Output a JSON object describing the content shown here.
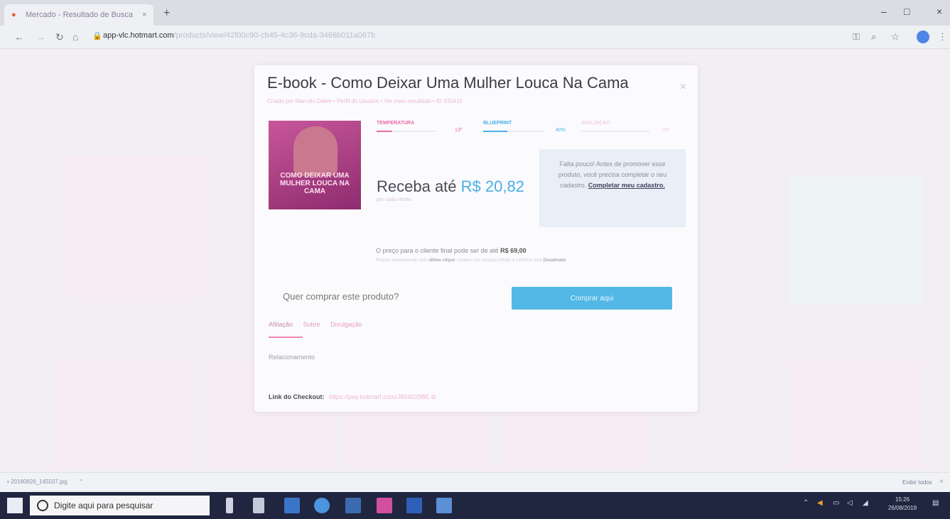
{
  "browser": {
    "tab_title": "Mercado - Resultado de Busca",
    "tab_close": "×",
    "new_tab": "+",
    "url_main": "app-vlc.hotmart.com",
    "url_path": "/products/view/42f00c90-cb45-4c36-9cda-3466b011a067b",
    "window_controls": {
      "minimize": "–",
      "maximize": "□",
      "close": "×"
    }
  },
  "modal": {
    "title": "E-book - Como Deixar Uma Mulher Louca Na Cama",
    "close": "×",
    "subtitle": "Criado por Marcelo Dalve  •  Perfil do Usuário  •  Ver mais resultado  •  ID 335415",
    "cover_caption": "COMO DEIXAR UMA MULHER LOUCA NA CAMA",
    "metrics": [
      {
        "label": "TEMPERATURA",
        "value": "13º"
      },
      {
        "label": "BLUEPRINT",
        "value": "40%"
      },
      {
        "label": "AVALIAÇÃO",
        "value": "0/5"
      }
    ],
    "receba_label": "Receba até",
    "receba_amount": "R$ 20,82",
    "receba_note": "por cada venda",
    "info_text": "Falta pouco! Antes de promover esse produto, você precisa completar o seu cadastro.",
    "info_link": "Completar meu cadastro.",
    "price_text": "O preço para o cliente final pode ser de até",
    "price_value": "R$ 69,00",
    "fine_prefix": "Produto comissionado pelo",
    "fine_bold1": "último clique",
    "fine_mid": ", cookies com duração infinita e o Prêmio está",
    "fine_bold2": "Desativado",
    "buy_question": "Quer comprar este produto?",
    "buy_button": "Comprar aqui",
    "tabs": [
      "Afiliação",
      "Sobre",
      "Divulgação"
    ],
    "section": "Relacionamento",
    "checkout_label": "Link do Checkout:",
    "checkout_url": "https://pay.hotmart.com/J8040298E"
  },
  "downloads": {
    "file": "20190826_145037.jpg",
    "show_all": "Exibir todos",
    "close": "×"
  },
  "taskbar": {
    "search_placeholder": "Digite aqui para pesquisar",
    "time": "15:26",
    "date": "26/08/2019"
  },
  "colors": {
    "accent_pink": "#ef86b4",
    "accent_blue": "#54b8e6",
    "taskbar": "#202640"
  }
}
